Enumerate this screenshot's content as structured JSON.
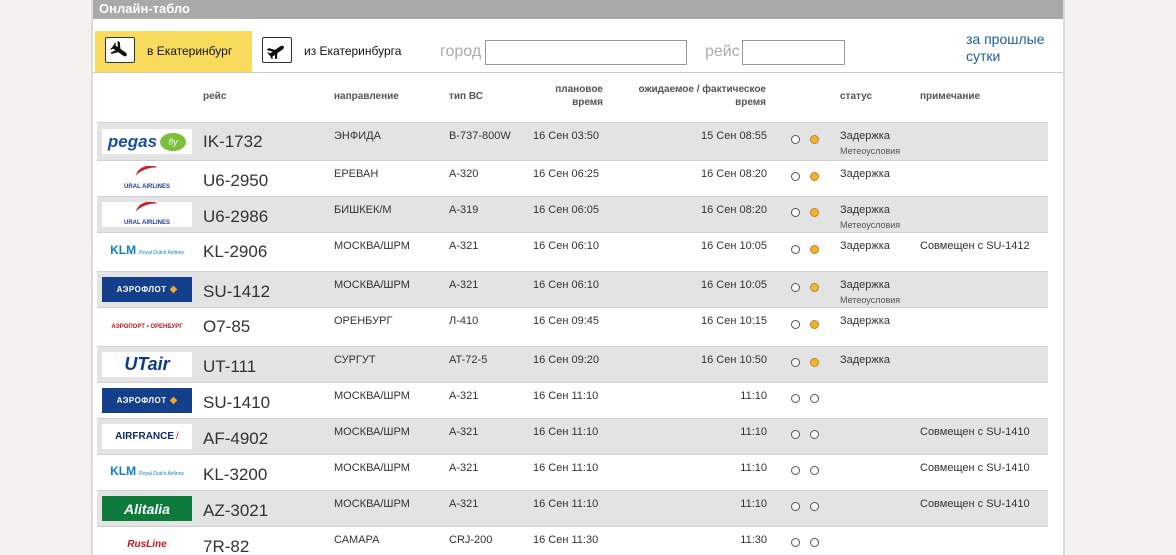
{
  "header": {
    "title": "Онлайн-табло"
  },
  "tabs": {
    "arrivals": {
      "label": "в Екатеринбург"
    },
    "departures": {
      "label": "из Екатеринбурга"
    }
  },
  "filters": {
    "city_label": "город",
    "flight_label": "рейс",
    "city_value": "",
    "flight_value": ""
  },
  "past_link": "за прошлые сутки",
  "columns": {
    "flight": "рейс",
    "direction": "направление",
    "aircraft": "тип ВС",
    "planned": "плановое время",
    "expected": "ожидаемое / фактическое время",
    "status": "статус",
    "note": "примечание"
  },
  "colors": {
    "header_bar": "#a9a9a9",
    "active_tab": "#f8db5c",
    "row_shade": "#e3e3e3",
    "status_dot_on": "#f3b231",
    "link": "#1f5ea8"
  },
  "flights": [
    {
      "logo": "pegas",
      "logo_text": "pegas fly",
      "flight": "IK-1732",
      "dest": "ЭНФИДА",
      "type": "B-737-800W",
      "planned": "16 Сен 03:50",
      "expected": "15 Сен 08:55",
      "status": "Задержка",
      "status_sub": "Метеоусловия",
      "note": "",
      "delayed": true
    },
    {
      "logo": "ural",
      "logo_text": "URAL AIRLINES",
      "flight": "U6-2950",
      "dest": "ЕРЕВАН",
      "type": "A-320",
      "planned": "16 Сен 06:25",
      "expected": "16 Сен 08:20",
      "status": "Задержка",
      "status_sub": "",
      "note": "",
      "delayed": true
    },
    {
      "logo": "ural",
      "logo_text": "URAL AIRLINES",
      "flight": "U6-2986",
      "dest": "БИШКЕК/М",
      "type": "A-319",
      "planned": "16 Сен 06:05",
      "expected": "16 Сен 08:20",
      "status": "Задержка",
      "status_sub": "Метеоусловия",
      "note": "",
      "delayed": true
    },
    {
      "logo": "klm",
      "logo_text": "KLM",
      "flight": "KL-2906",
      "dest": "МОСКВА/ШРМ",
      "type": "A-321",
      "planned": "16 Сен 06:10",
      "expected": "16 Сен 10:05",
      "status": "Задержка",
      "status_sub": "",
      "note": "Совмещен с SU-1412",
      "delayed": true
    },
    {
      "logo": "aeroflot",
      "logo_text": "АЭРОФЛОТ",
      "flight": "SU-1412",
      "dest": "МОСКВА/ШРМ",
      "type": "A-321",
      "planned": "16 Сен 06:10",
      "expected": "16 Сен 10:05",
      "status": "Задержка",
      "status_sub": "Метеоусловия",
      "note": "",
      "delayed": true
    },
    {
      "logo": "orenburg",
      "logo_text": "АЭРОПОРТ • ОРЕНБУРГ",
      "flight": "O7-85",
      "dest": "ОРЕНБУРГ",
      "type": "Л-410",
      "planned": "16 Сен 09:45",
      "expected": "16 Сен 10:15",
      "status": "Задержка",
      "status_sub": "",
      "note": "",
      "delayed": true
    },
    {
      "logo": "utair",
      "logo_text": "UTair",
      "flight": "UT-111",
      "dest": "СУРГУТ",
      "type": "AT-72-5",
      "planned": "16 Сен 09:20",
      "expected": "16 Сен 10:50",
      "status": "Задержка",
      "status_sub": "",
      "note": "",
      "delayed": true
    },
    {
      "logo": "aeroflot",
      "logo_text": "АЭРОФЛОТ",
      "flight": "SU-1410",
      "dest": "МОСКВА/ШРМ",
      "type": "A-321",
      "planned": "16 Сен 11:10",
      "expected": "11:10",
      "status": "",
      "status_sub": "",
      "note": "",
      "delayed": false
    },
    {
      "logo": "airfrance",
      "logo_text": "AIRFRANCE",
      "flight": "AF-4902",
      "dest": "МОСКВА/ШРМ",
      "type": "A-321",
      "planned": "16 Сен 11:10",
      "expected": "11:10",
      "status": "",
      "status_sub": "",
      "note": "Совмещен с SU-1410",
      "delayed": false
    },
    {
      "logo": "klm",
      "logo_text": "KLM",
      "flight": "KL-3200",
      "dest": "МОСКВА/ШРМ",
      "type": "A-321",
      "planned": "16 Сен 11:10",
      "expected": "11:10",
      "status": "",
      "status_sub": "",
      "note": "Совмещен с SU-1410",
      "delayed": false
    },
    {
      "logo": "alitalia",
      "logo_text": "Alitalia",
      "flight": "AZ-3021",
      "dest": "МОСКВА/ШРМ",
      "type": "A-321",
      "planned": "16 Сен 11:10",
      "expected": "11:10",
      "status": "",
      "status_sub": "",
      "note": "Совмещен с SU-1410",
      "delayed": false
    },
    {
      "logo": "rusline",
      "logo_text": "RusLine",
      "flight": "7R-82",
      "dest": "САМАРА",
      "type": "CRJ-200",
      "planned": "16 Сен 11:30",
      "expected": "11:30",
      "status": "",
      "status_sub": "",
      "note": "",
      "delayed": false
    }
  ]
}
